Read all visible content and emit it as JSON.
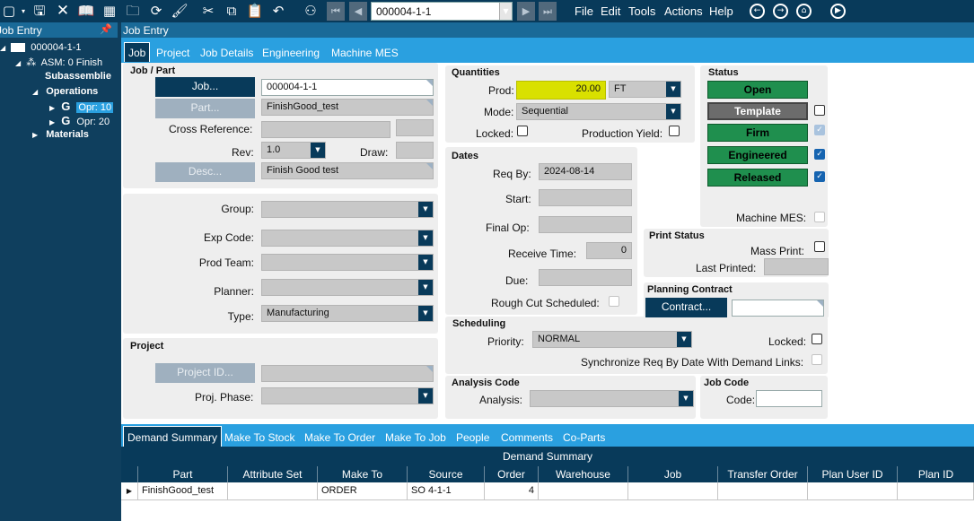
{
  "toolbar": {
    "job_value": "000004-1-1",
    "menus": [
      "File",
      "Edit",
      "Tools",
      "Actions",
      "Help"
    ]
  },
  "tree": {
    "header": "Job Entry",
    "root": "000004-1-1",
    "asm": "ASM: 0 Finish",
    "subassemblies": "Subassemblie",
    "operations": "Operations",
    "op1": "Opr: 10",
    "op2": "Opr: 20",
    "materials": "Materials"
  },
  "header": {
    "title": "Job Entry"
  },
  "main": {
    "tabs": [
      {
        "label": "Job"
      },
      {
        "label": "Project"
      },
      {
        "label": "Job Details"
      },
      {
        "label": "Engineering"
      },
      {
        "label": "Machine MES"
      }
    ]
  },
  "job_part": {
    "title": "Job / Part",
    "job_button": "Job...",
    "job_value": "000004-1-1",
    "part_button": "Part...",
    "part_value": "FinishGood_test",
    "cross_ref_label": "Cross Reference:",
    "rev_label": "Rev:",
    "rev_value": "1.0",
    "draw_label": "Draw:",
    "desc_button": "Desc...",
    "desc_value": "Finish Good test"
  },
  "classification": {
    "group_label": "Group:",
    "exp_code_label": "Exp Code:",
    "prod_team_label": "Prod Team:",
    "planner_label": "Planner:",
    "type_label": "Type:",
    "type_value": "Manufacturing"
  },
  "project": {
    "title": "Project",
    "project_id_button": "Project ID...",
    "phase_label": "Proj. Phase:"
  },
  "quantities": {
    "title": "Quantities",
    "prod_label": "Prod:",
    "prod_value": "20.00",
    "uom_value": "FT",
    "mode_label": "Mode:",
    "mode_value": "Sequential",
    "locked_label": "Locked:",
    "yield_label": "Production Yield:"
  },
  "dates": {
    "title": "Dates",
    "req_by_label": "Req By:",
    "req_by_value": "2024-08-14",
    "start_label": "Start:",
    "final_op_label": "Final Op:",
    "receive_time_label": "Receive Time:",
    "receive_time_value": "0",
    "due_label": "Due:",
    "rough_cut_label": "Rough Cut Scheduled:"
  },
  "scheduling": {
    "title": "Scheduling",
    "priority_label": "Priority:",
    "priority_value": "NORMAL",
    "locked_label": "Locked:",
    "sync_label": "Synchronize Req By Date With Demand Links:"
  },
  "analysis": {
    "title": "Analysis Code",
    "analysis_label": "Analysis:"
  },
  "job_code": {
    "title": "Job Code",
    "code_label": "Code:"
  },
  "status": {
    "title": "Status",
    "open": "Open",
    "template": "Template",
    "firm": "Firm",
    "engineered": "Engineered",
    "released": "Released",
    "machine_mes_label": "Machine MES:"
  },
  "print_status": {
    "title": "Print Status",
    "mass_print_label": "Mass Print:",
    "last_printed_label": "Last Printed:"
  },
  "planning_contract": {
    "title": "Planning Contract",
    "contract_button": "Contract..."
  },
  "bottom_tabs": [
    "Demand Summary",
    "Make To Stock",
    "Make To Order",
    "Make To Job",
    "People",
    "Comments",
    "Co-Parts"
  ],
  "demand_grid": {
    "caption": "Demand Summary",
    "columns": [
      "Part",
      "Attribute Set",
      "Make To",
      "Source",
      "Order",
      "Warehouse",
      "Job",
      "Transfer Order",
      "Plan User ID",
      "Plan ID"
    ],
    "rows": [
      [
        "FinishGood_test",
        "",
        "ORDER",
        "SO 4-1-1",
        "4",
        "",
        "",
        "",
        "",
        ""
      ]
    ]
  },
  "colors": {
    "dark_navy": "#083a5a",
    "tab_blue": "#2aa0e0",
    "status_green": "#1f8f4e",
    "highlight_yellow": "#d8e000"
  }
}
